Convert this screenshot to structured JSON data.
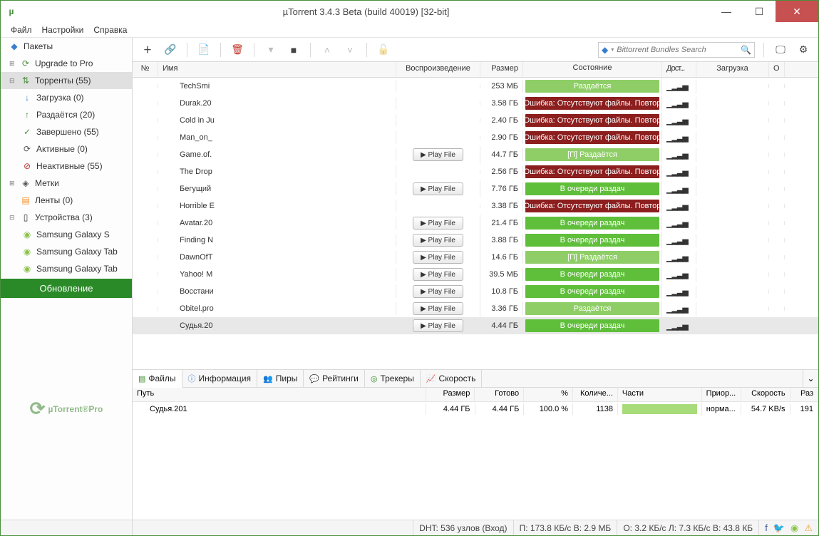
{
  "title": "µTorrent 3.4.3 Beta (build 40019) [32-bit]",
  "menu": {
    "file": "Файл",
    "settings": "Настройки",
    "help": "Справка"
  },
  "search_placeholder": "Bittorrent Bundles Search",
  "sidebar": {
    "packages": "Пакеты",
    "upgrade": "Upgrade to Pro",
    "torrents": "Торренты (55)",
    "downloading": "Загрузка (0)",
    "seeding": "Раздаётся (20)",
    "completed": "Завершено (55)",
    "active": "Активные (0)",
    "inactive": "Неактивные (55)",
    "labels": "Метки",
    "feeds": "Ленты (0)",
    "devices": "Устройства (3)",
    "dev1": "Samsung Galaxy S",
    "dev2": "Samsung Galaxy Tab",
    "dev3": "Samsung Galaxy Tab",
    "update": "Обновление",
    "pro": "µTorrent®Pro"
  },
  "cols": {
    "num": "№",
    "name": "Имя",
    "play": "Воспроизведение",
    "size": "Размер",
    "status": "Состояние",
    "avail": "Дост...",
    "dl": "Загрузка",
    "rest": "О"
  },
  "play_label": "Play File",
  "rows": [
    {
      "name": "TechSmi",
      "size": "253 МБ",
      "status": "Раздаётся",
      "st": "seed",
      "play": false
    },
    {
      "name": "Durak.20",
      "size": "3.58 ГБ",
      "status": "Ошибка: Отсутствуют файлы. Повтор",
      "st": "err",
      "play": false
    },
    {
      "name": "Cold in Ju",
      "size": "2.40 ГБ",
      "status": "Ошибка: Отсутствуют файлы. Повтор",
      "st": "err",
      "play": false
    },
    {
      "name": "Man_on_",
      "size": "2.90 ГБ",
      "status": "Ошибка: Отсутствуют файлы. Повтор",
      "st": "err",
      "play": false
    },
    {
      "name": "Game.of.",
      "size": "44.7 ГБ",
      "status": "[П] Раздаётся",
      "st": "seed",
      "play": true
    },
    {
      "name": "The Drop",
      "size": "2.56 ГБ",
      "status": "Ошибка: Отсутствуют файлы. Повтор",
      "st": "err",
      "play": false
    },
    {
      "name": "Бегущий",
      "size": "7.76 ГБ",
      "status": "В очереди раздач",
      "st": "queue",
      "play": true
    },
    {
      "name": "Horrible E",
      "size": "3.38 ГБ",
      "status": "Ошибка: Отсутствуют файлы. Повтор",
      "st": "err",
      "play": false
    },
    {
      "name": "Avatar.20",
      "size": "21.4 ГБ",
      "status": "В очереди раздач",
      "st": "queue",
      "play": true
    },
    {
      "name": "Finding N",
      "size": "3.88 ГБ",
      "status": "В очереди раздач",
      "st": "queue",
      "play": true
    },
    {
      "name": "DawnOfT",
      "size": "14.6 ГБ",
      "status": "[П] Раздаётся",
      "st": "seed",
      "play": true
    },
    {
      "name": "Yahoo! M",
      "size": "39.5 МБ",
      "status": "В очереди раздач",
      "st": "queue",
      "play": true
    },
    {
      "name": "Восстани",
      "size": "10.8 ГБ",
      "status": "В очереди раздач",
      "st": "queue",
      "play": true
    },
    {
      "name": "Obitel.pro",
      "size": "3.36 ГБ",
      "status": "Раздаётся",
      "st": "seed",
      "play": true
    },
    {
      "name": "Судья.20",
      "size": "4.44 ГБ",
      "status": "В очереди раздач",
      "st": "queue",
      "play": true,
      "sel": true
    }
  ],
  "tabs": {
    "files": "Файлы",
    "info": "Информация",
    "peers": "Пиры",
    "ratings": "Рейтинги",
    "trackers": "Трекеры",
    "speed": "Скорость"
  },
  "dcols": {
    "path": "Путь",
    "size": "Размер",
    "done": "Готово",
    "pct": "%",
    "cnt": "Количе...",
    "parts": "Части",
    "prio": "Приор...",
    "spd": "Скорость",
    "rest": "Раз"
  },
  "detail": {
    "path": "Судья.201",
    "size": "4.44 ГБ",
    "done": "4.44 ГБ",
    "pct": "100.0 %",
    "cnt": "1138",
    "prio": "норма...",
    "spd": "54.7 KB/s",
    "rest": "191"
  },
  "status": {
    "dht": "DHT: 536 узлов  (Вход)",
    "bw": "П: 173.8 КБ/с В: 2.9 МБ",
    "rate": "О: 3.2 КБ/с Л: 7.3 КБ/с В: 43.8 КБ"
  }
}
